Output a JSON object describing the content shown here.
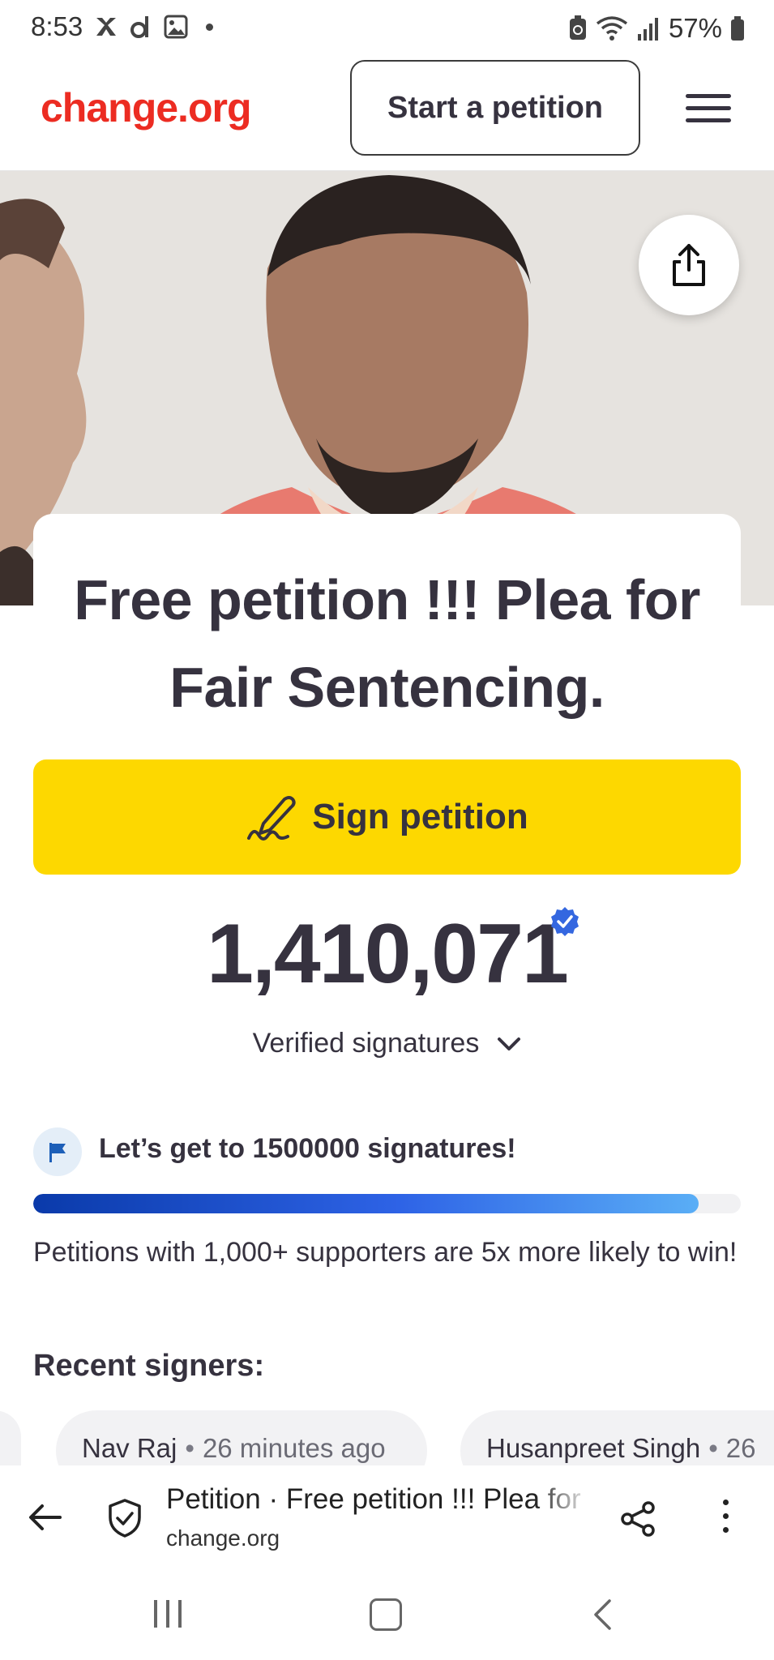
{
  "status_bar": {
    "time": "8:53",
    "battery": "57%"
  },
  "header": {
    "logo": "change.org",
    "start_petition": "Start a petition",
    "menu_icon": "hamburger-menu-icon"
  },
  "petition": {
    "title": "Free petition !!! Plea for Fair Sentencing.",
    "sign_label": "Sign petition",
    "signature_count": "1,410,071",
    "verified_label": "Verified signatures"
  },
  "goal": {
    "text": "Let’s get to 1500000 signatures!",
    "progress_fraction": 0.94,
    "note": "Petitions with 1,000+ supporters are 5x more likely to win!"
  },
  "recent": {
    "title": "Recent signers:",
    "signers": [
      {
        "name": "Nav Raj",
        "ago": "26 minutes ago"
      },
      {
        "name": "Husanpreet Singh",
        "ago": "26"
      }
    ],
    "separator": "•"
  },
  "browser": {
    "page_title": "Petition · Free petition !!! Plea for Fair Sentencing.",
    "host": "change.org"
  },
  "colors": {
    "brand": "#ec2c22",
    "sign_button": "#fdd800",
    "verified": "#3467e0",
    "text": "#36323f"
  }
}
